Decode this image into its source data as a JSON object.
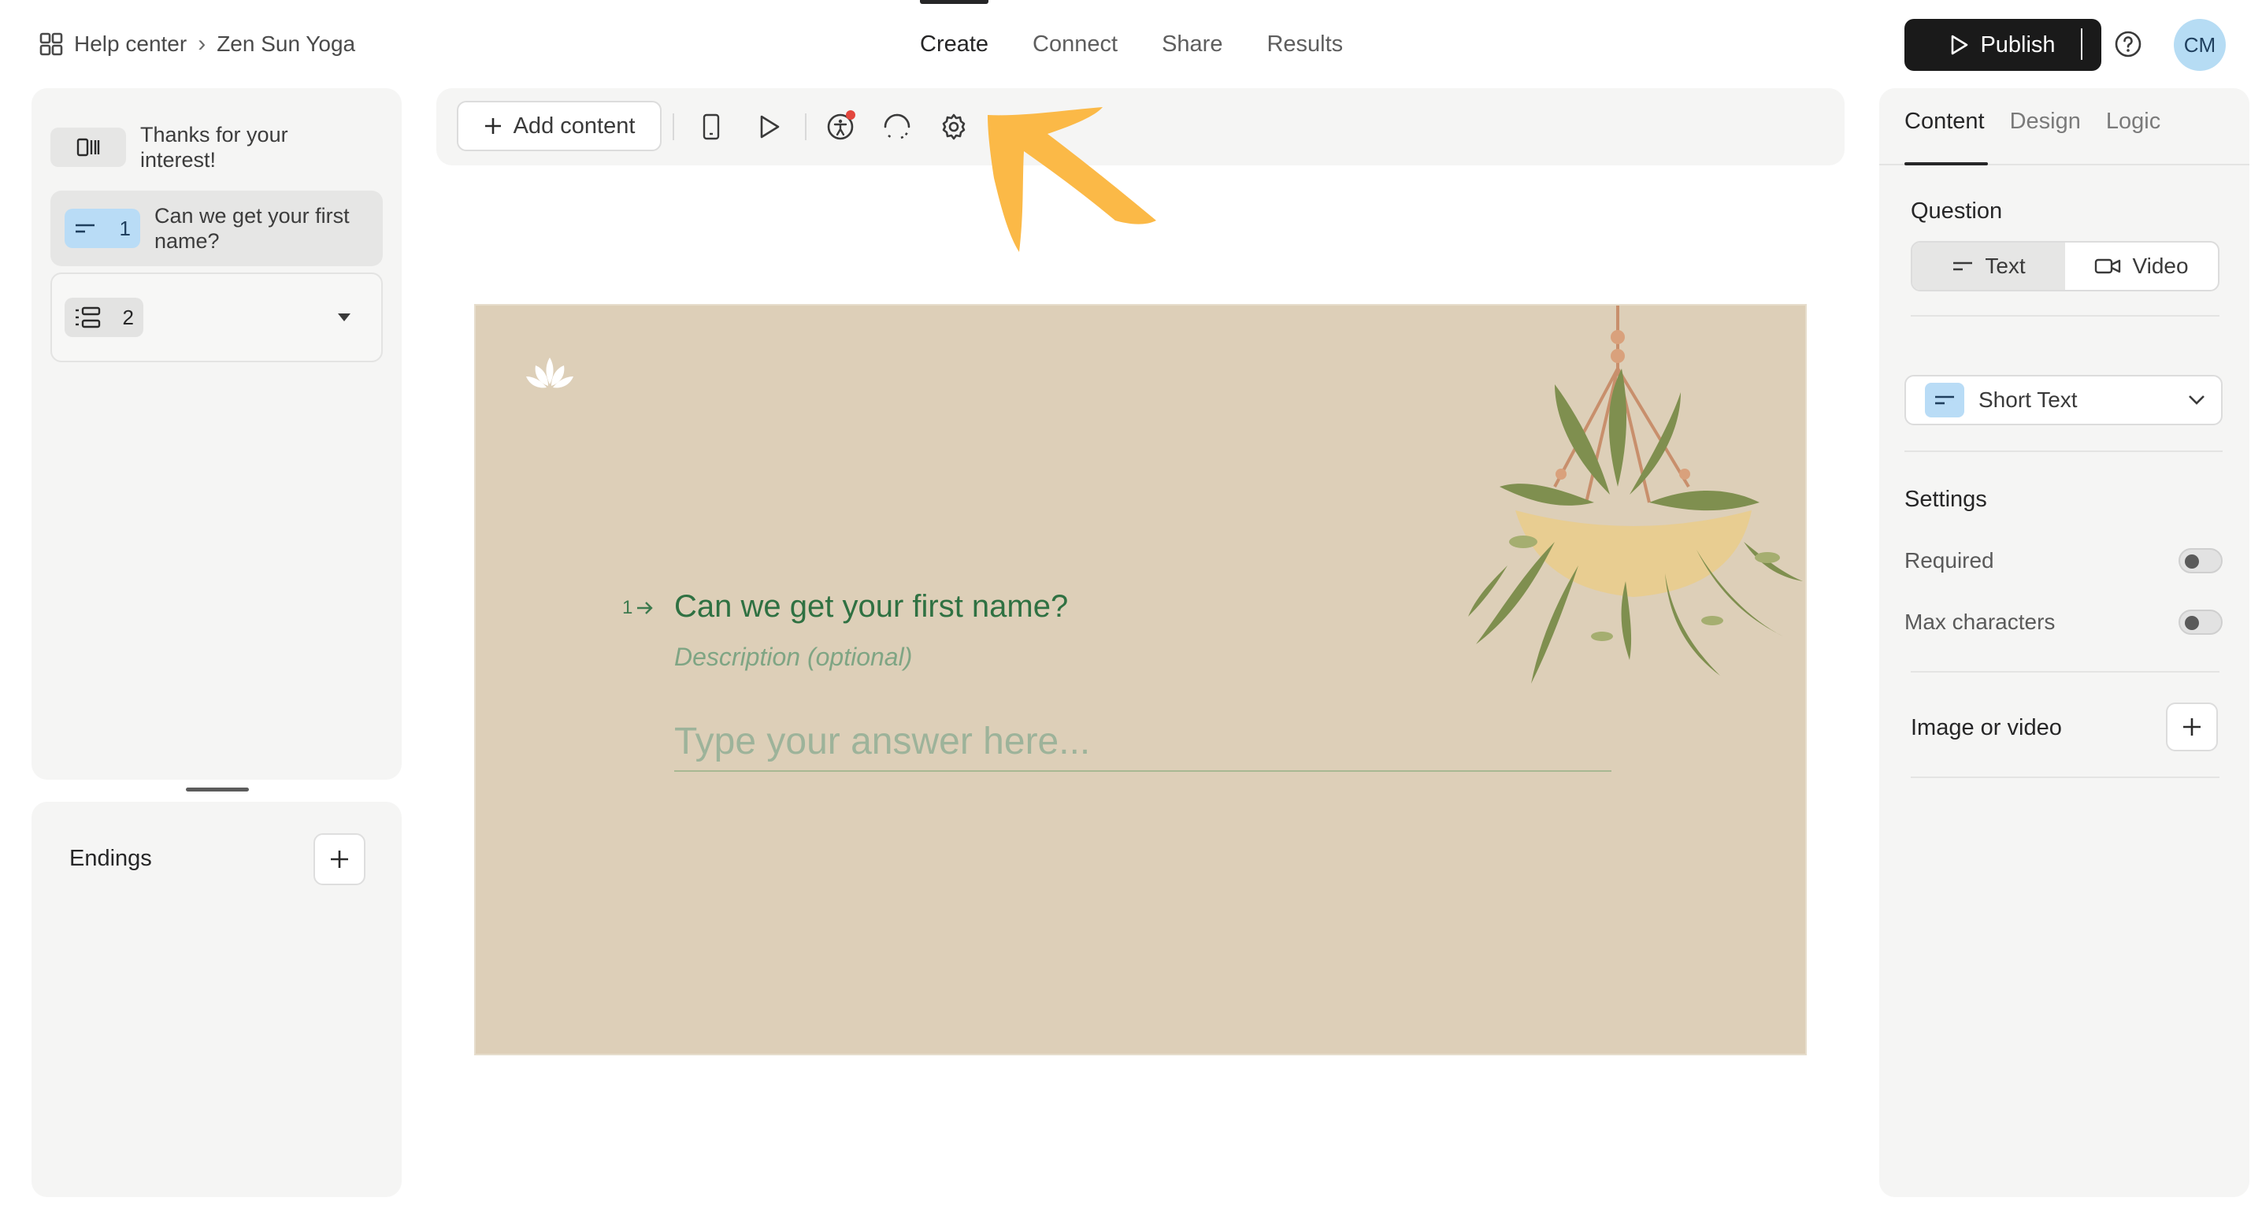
{
  "breadcrumb": {
    "home_icon": "grid-icon",
    "parent": "Help center",
    "separator": "›",
    "current": "Zen Sun Yoga"
  },
  "nav": {
    "tabs": [
      "Create",
      "Connect",
      "Share",
      "Results"
    ],
    "active": "Create"
  },
  "header": {
    "publish_label": "Publish",
    "help_icon": "question-circle-icon",
    "avatar_initials": "CM"
  },
  "colors": {
    "accent_dark": "#1a1a1a",
    "canvas_bg": "#ddcfb8",
    "question_green": "#2f7142",
    "arrow_orange": "#fbb947",
    "badge_blue": "#b9dcf6"
  },
  "left_panel": {
    "items": [
      {
        "icon": "welcome-screen-icon",
        "number": "",
        "label": "Thanks for your interest!"
      },
      {
        "icon": "short-text-icon",
        "number": "1",
        "label": "Can we get your first name?"
      },
      {
        "icon": "question-group-icon",
        "number": "2",
        "label": ""
      }
    ],
    "endings_title": "Endings"
  },
  "toolbar": {
    "add_content_label": "Add content"
  },
  "canvas": {
    "question_number": "1",
    "question_title": "Can we get your first name?",
    "description_placeholder": "Description (optional)",
    "answer_placeholder": "Type your answer here..."
  },
  "right_panel": {
    "tabs": [
      "Content",
      "Design",
      "Logic"
    ],
    "active_tab": "Content",
    "question_heading": "Question",
    "question_modes": [
      "Text",
      "Video"
    ],
    "active_mode": "Text",
    "question_type": "Short Text",
    "settings_heading": "Settings",
    "settings": [
      {
        "label": "Required",
        "on": false
      },
      {
        "label": "Max characters",
        "on": false
      }
    ],
    "media_label": "Image or video"
  }
}
